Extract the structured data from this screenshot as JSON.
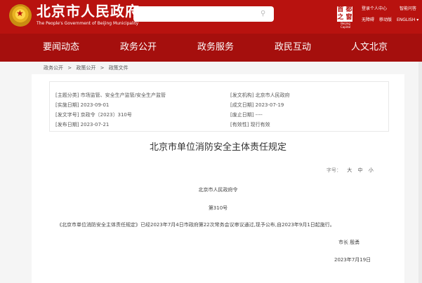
{
  "header": {
    "site_name": "北京市人民政府",
    "site_sub": "The People's Government of Beijing Municipality",
    "search_placeholder": "",
    "seal_text": "首 都 之 窗",
    "seal_sub": "Beijing Capital",
    "links": {
      "personal": "登录个人中心",
      "accessibility": "无障碍",
      "mobile": "移动版",
      "assistant": "智能问答",
      "lang": "ENGLISH ▾"
    }
  },
  "nav": {
    "items": [
      "要闻动态",
      "政务公开",
      "政务服务",
      "政民互动",
      "人文北京"
    ]
  },
  "breadcrumb": {
    "items": [
      "政务公开",
      ">",
      "政策公开",
      ">",
      "政策文件"
    ]
  },
  "meta": {
    "topic": "[主题分类] 市场监管、安全生产监管/安全生产监管",
    "issuer": "[发文机构] 北京市人民政府",
    "effective_date": "[实施日期] 2023-09-01",
    "written_date": "[成文日期] 2023-07-19",
    "doc_number": "[发文字号] 京政令〔2023〕310号",
    "abolish_date": "[废止日期] ----",
    "publish_date": "[发布日期] 2023-07-21",
    "validity": "[有效性] 现行有效"
  },
  "doc": {
    "title": "北京市单位消防安全主体责任规定",
    "font_size_label": "字号：",
    "font_sizes": [
      "大",
      "中",
      "小"
    ],
    "issuer_line": "北京市人民政府令",
    "number_line": "第310号",
    "body": "《北京市单位消防安全主体责任规定》已经2023年7月4日市政府第22次常务会议审议通过,现予公布,自2023年9月1日起施行。",
    "signature": "市长  殷勇",
    "sign_date": "2023年7月19日"
  },
  "colors": {
    "header_red": "#b8120f",
    "nav_red": "#a50f0d"
  }
}
